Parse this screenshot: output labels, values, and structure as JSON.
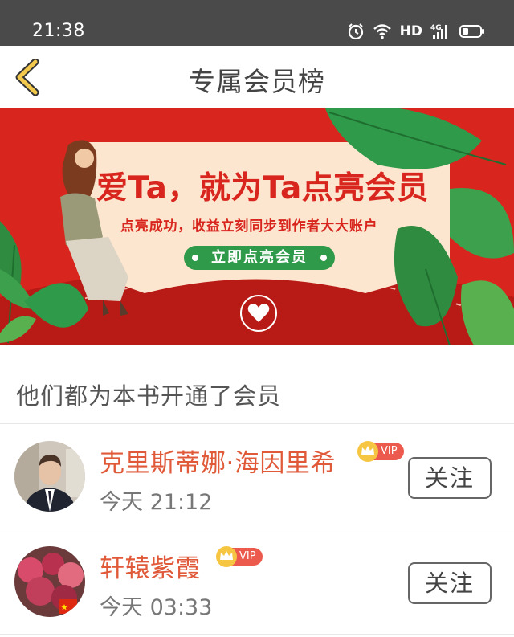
{
  "status_bar": {
    "time": "21:38",
    "network_label": "HD",
    "signal_label": "4G",
    "icons": [
      "alarm-icon",
      "wifi-icon",
      "signal-icon",
      "battery-icon"
    ]
  },
  "nav": {
    "title": "专属会员榜",
    "back_icon": "chevron-left-icon",
    "accent_color": "#f2c94c"
  },
  "banner": {
    "headline": "爱Ta，就为Ta点亮会员",
    "subtext": "点亮成功，收益立刻同步到作者大大账户",
    "cta_label": "立即点亮会员",
    "background_color": "#d8251d",
    "card_color": "#fde6cf",
    "cta_color": "#2e9a4a"
  },
  "section": {
    "title": "他们都为本书开通了会员"
  },
  "members": [
    {
      "name": "克里斯蒂娜·海因里希",
      "badge": "VIP",
      "time": "今天 21:12",
      "follow_label": "关注"
    },
    {
      "name": "轩辕紫霞",
      "badge": "VIP",
      "time": "今天 03:33",
      "follow_label": "关注"
    }
  ]
}
